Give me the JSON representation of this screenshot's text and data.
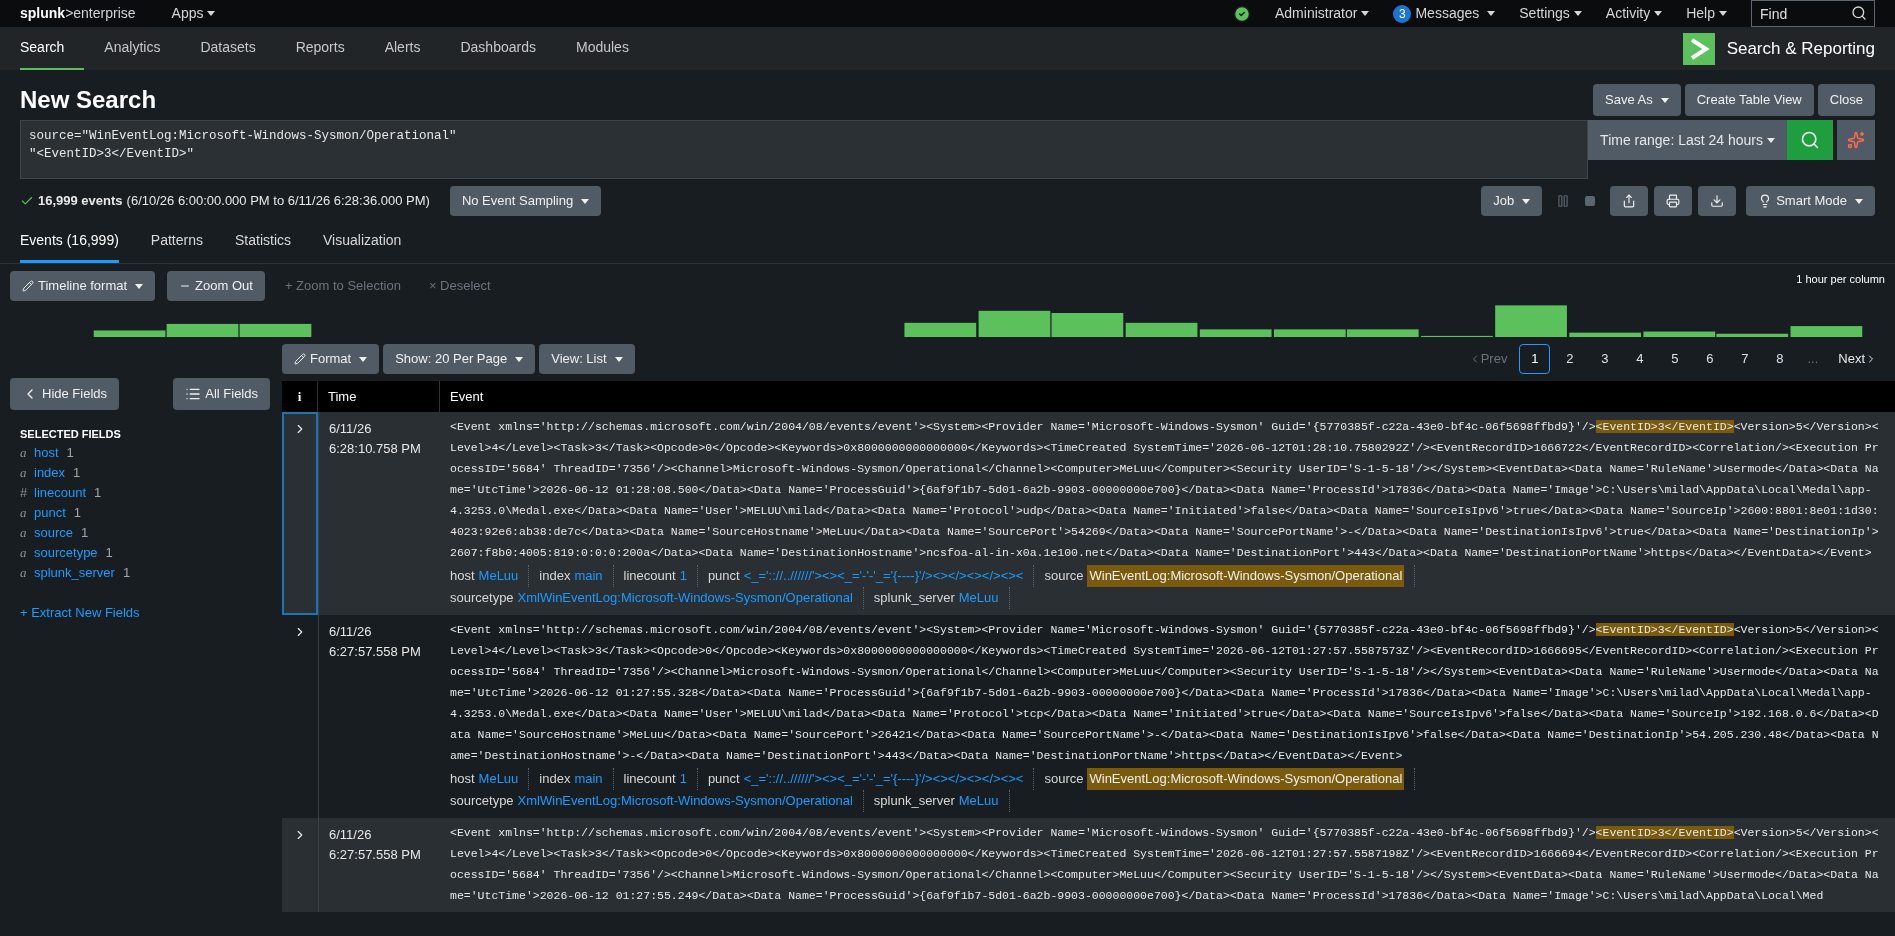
{
  "top_bar": {
    "brand": "splunk",
    "product": ">enterprise",
    "apps": "Apps",
    "user": "Administrator",
    "messages": {
      "count": "3",
      "label": "Messages"
    },
    "menus": [
      "Settings",
      "Activity",
      "Help"
    ],
    "find": {
      "placeholder": "Find"
    }
  },
  "nav": {
    "items": [
      {
        "label": "Search",
        "selected": true
      },
      {
        "label": "Analytics",
        "selected": false
      },
      {
        "label": "Datasets",
        "selected": false
      },
      {
        "label": "Reports",
        "selected": false
      },
      {
        "label": "Alerts",
        "selected": false
      },
      {
        "label": "Dashboards",
        "selected": false
      },
      {
        "label": "Modules",
        "selected": false
      }
    ],
    "app_title": "Search & Reporting"
  },
  "search": {
    "title": "New Search",
    "buttons": [
      {
        "label": "Save As",
        "dropdown": true
      },
      {
        "label": "Create Table View",
        "dropdown": false
      },
      {
        "label": "Close",
        "dropdown": false
      }
    ],
    "query_lines": [
      "source=\"WinEventLog:Microsoft-Windows-Sysmon/Operational\"",
      "\"<EventID>3</EventID>\""
    ],
    "time_range": "Time range: Last 24 hours"
  },
  "status": {
    "count": "16,999 events",
    "range": "(6/10/26 6:00:00.000 PM to 6/11/26 6:28:36.000 PM)",
    "sampling": "No Event Sampling",
    "job": "Job",
    "smart_mode": "Smart Mode"
  },
  "result_tabs": [
    {
      "label": "Events (16,999)",
      "selected": true
    },
    {
      "label": "Patterns",
      "selected": false
    },
    {
      "label": "Statistics",
      "selected": false
    },
    {
      "label": "Visualization",
      "selected": false
    }
  ],
  "timeline": {
    "format": "Timeline format",
    "zoom_out": "Zoom Out",
    "zoom_selection": "+ Zoom to Selection",
    "deselect": "× Deselect",
    "scale": "1 hour per column"
  },
  "list_controls": {
    "format": "Format",
    "per_page": "Show: 20 Per Page",
    "view": "View: List"
  },
  "pagination": {
    "prev": "Prev",
    "pages": [
      {
        "label": "1",
        "selected": true
      },
      {
        "label": "2",
        "selected": false
      },
      {
        "label": "3",
        "selected": false
      },
      {
        "label": "4",
        "selected": false
      },
      {
        "label": "5",
        "selected": false
      },
      {
        "label": "6",
        "selected": false
      },
      {
        "label": "7",
        "selected": false
      },
      {
        "label": "8",
        "selected": false
      }
    ],
    "ellipsis": "...",
    "next": "Next"
  },
  "sidebar": {
    "hide": "Hide Fields",
    "all": "All Fields",
    "heading": "SELECTED FIELDS",
    "fields": [
      {
        "type": "a",
        "name": "host",
        "count": "1"
      },
      {
        "type": "a",
        "name": "index",
        "count": "1"
      },
      {
        "type": "#",
        "name": "linecount",
        "count": "1"
      },
      {
        "type": "a",
        "name": "punct",
        "count": "1"
      },
      {
        "type": "a",
        "name": "source",
        "count": "1"
      },
      {
        "type": "a",
        "name": "sourcetype",
        "count": "1"
      },
      {
        "type": "a",
        "name": "splunk_server",
        "count": "1"
      }
    ],
    "extract": "+ Extract New Fields"
  },
  "table": {
    "columns": [
      "i",
      "Time",
      "Event"
    ],
    "events": [
      {
        "selected": true,
        "date": "6/11/26",
        "time": "6:28:10.758 PM",
        "raw": [
          {
            "text": "<Event xmlns='http://schemas.microsoft.com/win/2004/08/events/event'><System><Provider Name='Microsoft-Windows-Sysmon' Guid='{5770385f-c22a-43e0-bf4c-06f5698ffbd9}'/>",
            "highlighted": false
          },
          {
            "text": "<EventID>3</EventID>",
            "highlighted": true
          },
          {
            "text": "<Version>5</Version><Level>4</Level><Task>3</Task><Opcode>0</Opcode><Keywords>0x8000000000000000</Keywords><TimeCreated SystemTime='2026-06-12T01:28:10.7580292Z'/><EventRecordID>1666722</EventRecordID><Correlation/><Execution ProcessID='5684' ThreadID='7356'/><Channel>Microsoft-Windows-Sysmon/Operational</Channel><Computer>MeLuu</Computer><Security UserID='S-1-5-18'/></System><EventData><Data Name='RuleName'>Usermode</Data><Data Name='UtcTime'>2026-06-12 01:28:08.500</Data><Data Name='ProcessGuid'>{6af9f1b7-5d01-6a2b-9903-00000000e700}</Data><Data Name='ProcessId'>17836</Data><Data Name='Image'>C:\\Users\\milad\\AppData\\Local\\Medal\\app-4.3253.0\\Medal.exe</Data><Data Name='User'>MELUU\\milad</Data><Data Name='Protocol'>udp</Data><Data Name='Initiated'>false</Data><Data Name='SourceIsIpv6'>true</Data><Data Name='SourceIp'>2600:8801:8e01:1d30:4023:92e6:ab38:de7c</Data><Data Name='SourceHostname'>MeLuu</Data><Data Name='SourcePort'>54269</Data><Data Name='SourcePortName'>-</Data><Data Name='DestinationIsIpv6'>true</Data><Data Name='DestinationIp'>2607:f8b0:4005:819:0:0:0:200a</Data><Data Name='DestinationHostname'>ncsfoa-al-in-x0a.1e100.net</Data><Data Name='DestinationPort'>443</Data><Data Name='DestinationPortName'>https</Data></EventData></Event>",
            "highlighted": false
          }
        ],
        "fields": [
          {
            "key": "host",
            "value": "MeLuu",
            "highlighted": false
          },
          {
            "key": "index",
            "value": "main",
            "highlighted": false
          },
          {
            "key": "linecount",
            "value": "1",
            "highlighted": false
          },
          {
            "key": "punct",
            "value": "<_=':://..//////'><><_='-'-'_='{----}'/><></><></><><",
            "highlighted": false
          },
          {
            "key": "source",
            "value": "WinEventLog:Microsoft-Windows-Sysmon/Operational",
            "highlighted": true
          },
          {
            "key": "sourcetype",
            "value": "XmlWinEventLog:Microsoft-Windows-Sysmon/Operational",
            "highlighted": false
          },
          {
            "key": "splunk_server",
            "value": "MeLuu",
            "highlighted": false
          }
        ]
      },
      {
        "selected": false,
        "date": "6/11/26",
        "time": "6:27:57.558 PM",
        "raw": [
          {
            "text": "<Event xmlns='http://schemas.microsoft.com/win/2004/08/events/event'><System><Provider Name='Microsoft-Windows-Sysmon' Guid='{5770385f-c22a-43e0-bf4c-06f5698ffbd9}'/>",
            "highlighted": false
          },
          {
            "text": "<EventID>3</EventID>",
            "highlighted": true
          },
          {
            "text": "<Version>5</Version><Level>4</Level><Task>3</Task><Opcode>0</Opcode><Keywords>0x8000000000000000</Keywords><TimeCreated SystemTime='2026-06-12T01:27:57.5587573Z'/><EventRecordID>1666695</EventRecordID><Correlation/><Execution ProcessID='5684' ThreadID='7356'/><Channel>Microsoft-Windows-Sysmon/Operational</Channel><Computer>MeLuu</Computer><Security UserID='S-1-5-18'/></System><EventData><Data Name='RuleName'>Usermode</Data><Data Name='UtcTime'>2026-06-12 01:27:55.328</Data><Data Name='ProcessGuid'>{6af9f1b7-5d01-6a2b-9903-00000000e700}</Data><Data Name='ProcessId'>17836</Data><Data Name='Image'>C:\\Users\\milad\\AppData\\Local\\Medal\\app-4.3253.0\\Medal.exe</Data><Data Name='User'>MELUU\\milad</Data><Data Name='Protocol'>tcp</Data><Data Name='Initiated'>true</Data><Data Name='SourceIsIpv6'>false</Data><Data Name='SourceIp'>192.168.0.6</Data><Data Name='SourceHostname'>MeLuu</Data><Data Name='SourcePort'>26421</Data><Data Name='SourcePortName'>-</Data><Data Name='DestinationIsIpv6'>false</Data><Data Name='DestinationIp'>54.205.230.48</Data><Data Name='DestinationHostname'>-</Data><Data Name='DestinationPort'>443</Data><Data Name='DestinationPortName'>https</Data></EventData></Event>",
            "highlighted": false
          }
        ],
        "fields": [
          {
            "key": "host",
            "value": "MeLuu",
            "highlighted": false
          },
          {
            "key": "index",
            "value": "main",
            "highlighted": false
          },
          {
            "key": "linecount",
            "value": "1",
            "highlighted": false
          },
          {
            "key": "punct",
            "value": "<_=':://..//////'><><_='-'-'_='{----}'/><></><></><><",
            "highlighted": false
          },
          {
            "key": "source",
            "value": "WinEventLog:Microsoft-Windows-Sysmon/Operational",
            "highlighted": true
          },
          {
            "key": "sourcetype",
            "value": "XmlWinEventLog:Microsoft-Windows-Sysmon/Operational",
            "highlighted": false
          },
          {
            "key": "splunk_server",
            "value": "MeLuu",
            "highlighted": false
          }
        ]
      },
      {
        "selected": false,
        "date": "6/11/26",
        "time": "6:27:57.558 PM",
        "raw": [
          {
            "text": "<Event xmlns='http://schemas.microsoft.com/win/2004/08/events/event'><System><Provider Name='Microsoft-Windows-Sysmon' Guid='{5770385f-c22a-43e0-bf4c-06f5698ffbd9}'/>",
            "highlighted": false
          },
          {
            "text": "<EventID>3</EventID>",
            "highlighted": true
          },
          {
            "text": "<Version>5</Version><Level>4</Level><Task>3</Task><Opcode>0</Opcode><Keywords>0x8000000000000000</Keywords><TimeCreated SystemTime='2026-06-12T01:27:57.5587198Z'/><EventRecordID>1666694</EventRecordID><Correlation/><Execution ProcessID='5684' ThreadID='7356'/><Channel>Microsoft-Windows-Sysmon/Operational</Channel><Computer>MeLuu</Computer><Security UserID='S-1-5-18'/></System><EventData><Data Name='RuleName'>Usermode</Data><Data Name='UtcTime'>2026-06-12 01:27:55.249</Data><Data Name='ProcessGuid'>{6af9f1b7-5d01-6a2b-9903-00000000e700}</Data><Data Name='ProcessId'>17836</Data><Data Name='Image'>C:\\Users\\milad\\AppData\\Local\\Med",
            "highlighted": false
          }
        ]
      }
    ]
  }
}
